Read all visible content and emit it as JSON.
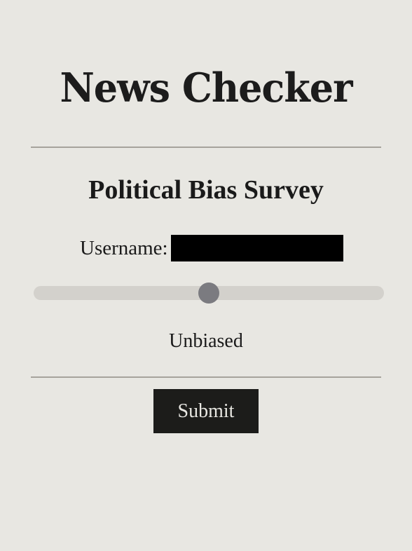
{
  "header": {
    "logo_text": "News Checker"
  },
  "survey": {
    "title": "Political Bias Survey",
    "username_label": "Username:",
    "username_value": "",
    "bias_slider_fraction": 0.5,
    "bias_value_label": "Unbiased",
    "submit_label": "Submit"
  },
  "colors": {
    "background": "#e8e7e2",
    "text": "#1a1a1a",
    "slider_track": "#d3d1cc",
    "slider_thumb": "#7b7b80",
    "button_background": "#1c1c1a",
    "button_text": "#e8e7e2",
    "divider": "#a6a39c"
  }
}
